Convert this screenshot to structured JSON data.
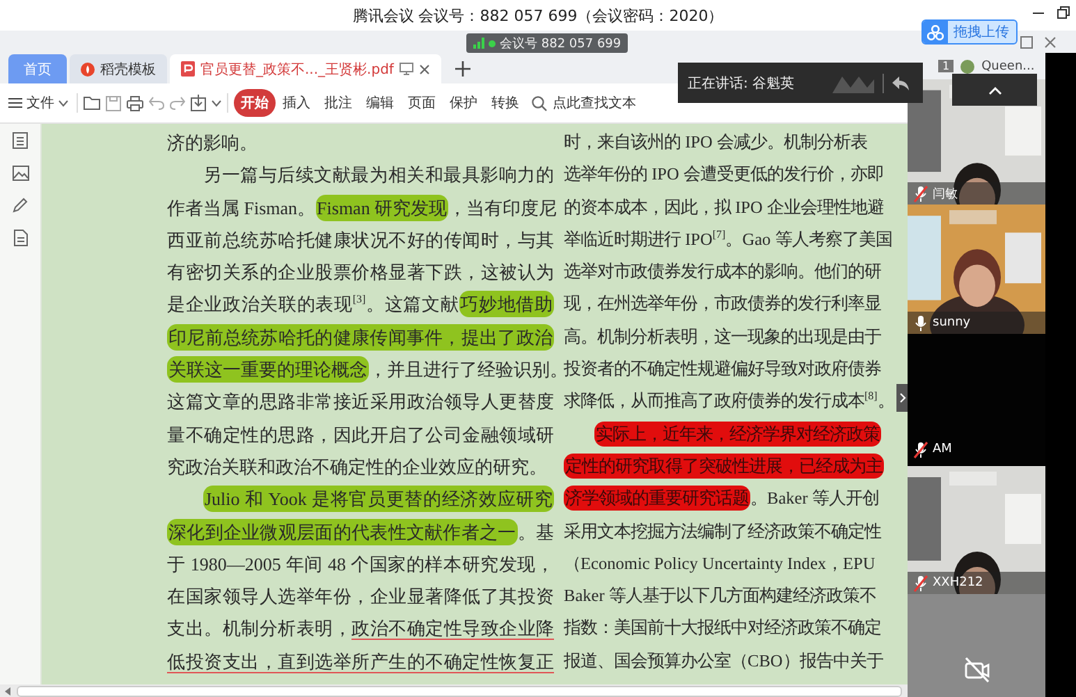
{
  "title_bar": {
    "title": "腾讯会议 会议号：882 057 699（会议密码：2020）"
  },
  "upload_button": {
    "label": "拖拽上传"
  },
  "meeting_badge": {
    "label": "会议号 882 057 699"
  },
  "tabs": [
    {
      "label": "首页",
      "selected": false,
      "kind": "home"
    },
    {
      "label": "稻壳模板",
      "selected": false,
      "kind": "template"
    },
    {
      "label": "官员更替_政策不..._王贤彬.pdf",
      "selected": true,
      "kind": "pdf"
    }
  ],
  "toolbar": {
    "file_menu": "文件",
    "items": [
      {
        "label": "开始",
        "selected": true
      },
      {
        "label": "插入",
        "selected": false
      },
      {
        "label": "批注",
        "selected": false
      },
      {
        "label": "编辑",
        "selected": false
      },
      {
        "label": "页面",
        "selected": false
      },
      {
        "label": "保护",
        "selected": false
      },
      {
        "label": "转换",
        "selected": false
      }
    ],
    "search": {
      "placeholder": "点此查找文本"
    }
  },
  "speaker": {
    "label": "正在讲话: 谷魁英"
  },
  "panel": {
    "count": "1",
    "user": "Queen..."
  },
  "participants": [
    {
      "name": "闫敏",
      "muted": true,
      "kind": "video"
    },
    {
      "name": "sunny",
      "muted": false,
      "kind": "video"
    },
    {
      "name": "AM",
      "muted": true,
      "kind": "off"
    },
    {
      "name": "XXH212",
      "muted": true,
      "kind": "video"
    },
    {
      "kind": "no-camera"
    }
  ],
  "document": {
    "left_column": [
      {
        "kind": "last",
        "segments": [
          {
            "text": "济的影响。"
          }
        ]
      },
      {
        "kind": "first",
        "segments": [
          {
            "text": "另一篇与后续文献最为相关和最具影响力的"
          }
        ]
      },
      {
        "kind": "body",
        "segments": [
          {
            "text": "作者当属 Fisman。"
          },
          {
            "text": "Fisman 研究发现",
            "kind": "highlight"
          },
          {
            "text": "，当有印度尼"
          }
        ]
      },
      {
        "kind": "body",
        "segments": [
          {
            "text": "西亚前总统苏哈托健康状况不好的传闻时，与其"
          }
        ]
      },
      {
        "kind": "body",
        "segments": [
          {
            "text": "有密切关系的企业股票价格显著下跌，这被认为"
          }
        ]
      },
      {
        "kind": "body",
        "segments": [
          {
            "text": "是企业政治关联的表现$^{[3]}$。这篇文献"
          },
          {
            "text": "巧妙地借助",
            "kind": "highlight"
          }
        ]
      },
      {
        "kind": "body",
        "segments": [
          {
            "text": "印尼前总统苏哈托的健康传闻事件，提出了政治",
            "kind": "highlight"
          }
        ]
      },
      {
        "kind": "body",
        "segments": [
          {
            "text": "关联这一重要的理论概念",
            "kind": "highlight"
          },
          {
            "text": "，并且进行了经验识别。"
          }
        ]
      },
      {
        "kind": "body",
        "segments": [
          {
            "text": "这篇文章的思路非常接近采用政治领导人更替度"
          }
        ]
      },
      {
        "kind": "body",
        "segments": [
          {
            "text": "量不确定性的思路，因此开启了公司金融领域研"
          }
        ]
      },
      {
        "kind": "last",
        "segments": [
          {
            "text": "究政治关联和政治不确定性的企业效应的研究。"
          }
        ]
      },
      {
        "kind": "first",
        "segments": [
          {
            "text": "Julio 和 Yook 是将官员更替的经济效应研究",
            "kind": "highlight"
          }
        ]
      },
      {
        "kind": "body",
        "segments": [
          {
            "text": "深化到企业微观层面的代表性文献作者之一",
            "kind": "highlight"
          },
          {
            "text": "。基"
          }
        ]
      },
      {
        "kind": "body",
        "segments": [
          {
            "text": "于 1980—2005 年间 48 个国家的样本研究发现，"
          }
        ]
      },
      {
        "kind": "body",
        "segments": [
          {
            "text": "在国家领导人选举年份，企业显著降低了其投资"
          }
        ]
      },
      {
        "kind": "body",
        "segments": [
          {
            "text": "支出。机制分析表明，"
          },
          {
            "text": "政治不确定性导致企业降",
            "kind": "underline"
          }
        ]
      },
      {
        "kind": "body",
        "segments": [
          {
            "text": "低投资支出，直到选举所产生的不确定性恢复正",
            "kind": "underline"
          }
        ]
      }
    ],
    "right_column": [
      {
        "kind": "body",
        "segments": [
          {
            "text": "时，来自该州的 IPO 会减少。机制分析表"
          }
        ]
      },
      {
        "kind": "body",
        "segments": [
          {
            "text": "选举年份的 IPO 会遭受更低的发行价，亦即"
          }
        ]
      },
      {
        "kind": "body",
        "segments": [
          {
            "text": "的资本成本，因此，拟 IPO 企业会理性地避"
          }
        ]
      },
      {
        "kind": "body",
        "segments": [
          {
            "text": "举临近时期进行 IPO$^{[7]}$。Gao 等人考察了美国"
          }
        ]
      },
      {
        "kind": "body",
        "segments": [
          {
            "text": "选举对市政债券发行成本的影响。他们的研"
          }
        ]
      },
      {
        "kind": "body",
        "segments": [
          {
            "text": "现，在州选举年份，市政债券的发行利率显"
          }
        ]
      },
      {
        "kind": "body",
        "segments": [
          {
            "text": "高。机制分析表明，这一现象的出现是由于"
          }
        ]
      },
      {
        "kind": "body",
        "segments": [
          {
            "text": "投资者的不确定性规避偏好导致对政府债券"
          }
        ]
      },
      {
        "kind": "body",
        "segments": [
          {
            "text": "求降低，从而推高了政府债券的发行成本$^{[8]}$。"
          }
        ]
      },
      {
        "kind": "first",
        "segments": [
          {
            "text": "实际上，近年来，经济学界对经济政策",
            "kind": "red-highlight"
          }
        ]
      },
      {
        "kind": "body",
        "segments": [
          {
            "text": "定性的研究取得了突破性进展，已经成为主",
            "kind": "red-highlight"
          }
        ]
      },
      {
        "kind": "body",
        "segments": [
          {
            "text": "济学领域的重要研究话题",
            "kind": "red-highlight"
          },
          {
            "text": "。Baker 等人开创"
          }
        ]
      },
      {
        "kind": "body",
        "segments": [
          {
            "text": "采用文本挖掘方法编制了经济政策不确定性"
          }
        ]
      },
      {
        "kind": "body",
        "segments": [
          {
            "text": "（Economic Policy Uncertainty Index，EPU"
          }
        ]
      },
      {
        "kind": "body",
        "segments": [
          {
            "text": "Baker 等人基于以下几方面构建经济政策不"
          }
        ]
      },
      {
        "kind": "body",
        "segments": [
          {
            "text": "指数：美国前十大报纸中对经济政策不确定"
          }
        ]
      },
      {
        "kind": "body",
        "segments": [
          {
            "text": "报道、国会预算办公室（CBO）报告中关于"
          }
        ]
      }
    ]
  }
}
